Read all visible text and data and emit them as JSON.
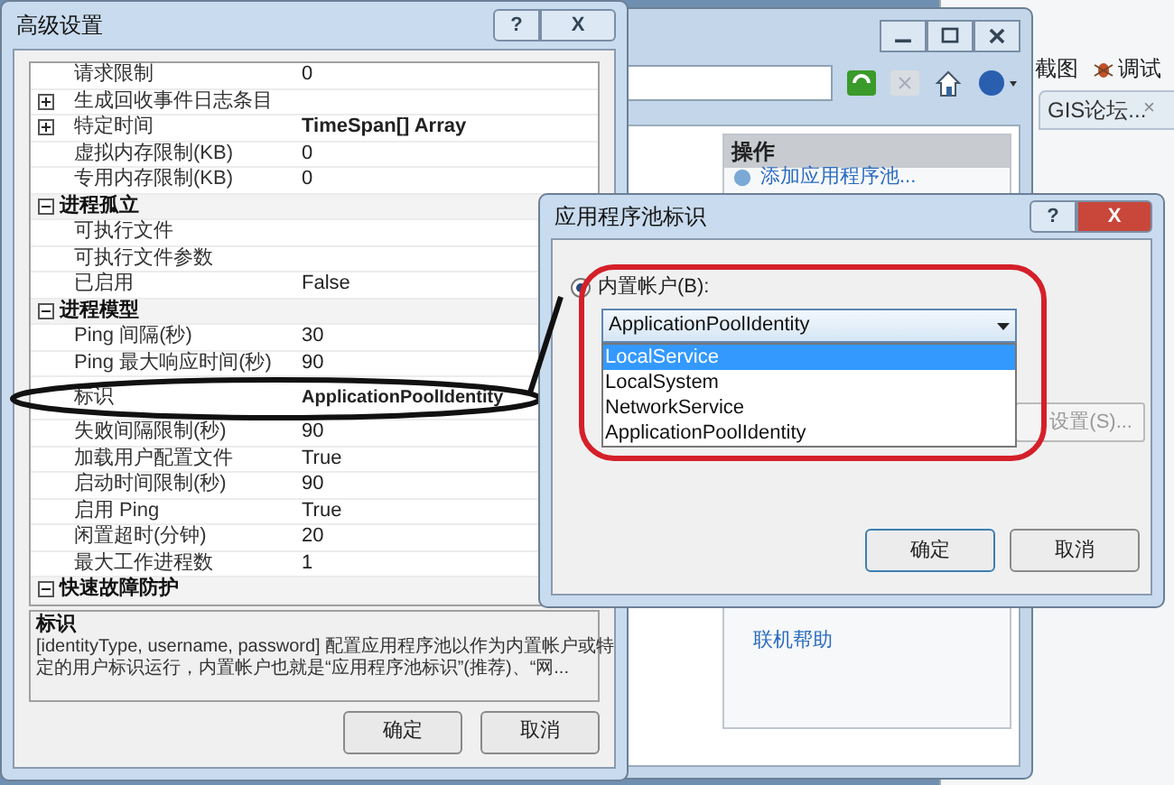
{
  "browser": {
    "toolbar": [
      "截图",
      "调试"
    ],
    "tab": {
      "label": "GIS论坛...",
      "close": "×"
    }
  },
  "iis_window": {
    "actions": {
      "title": "操作",
      "items": [
        "添加应用程序池...",
        "联机帮助"
      ]
    }
  },
  "advanced_settings": {
    "title": "高级设置",
    "help": "?",
    "close": "X",
    "rows": [
      {
        "kind": "property",
        "name": "请求限制",
        "value": "0",
        "bold": false
      },
      {
        "kind": "property",
        "expanded": false,
        "name": "生成回收事件日志条目"
      },
      {
        "kind": "property",
        "expanded": false,
        "name": "特定时间",
        "value": "TimeSpan[] Array",
        "bold": true
      },
      {
        "kind": "property",
        "name": "虚拟内存限制(KB)",
        "value": "0",
        "bold": false
      },
      {
        "kind": "property",
        "name": "专用内存限制(KB)",
        "value": "0",
        "bold": false
      },
      {
        "kind": "category",
        "expanded": true,
        "name": "进程孤立"
      },
      {
        "kind": "property",
        "name": "可执行文件"
      },
      {
        "kind": "property",
        "name": "可执行文件参数"
      },
      {
        "kind": "property",
        "name": "已启用",
        "value": "False",
        "bold": false
      },
      {
        "kind": "category",
        "expanded": true,
        "name": "进程模型"
      },
      {
        "kind": "property",
        "name": "Ping 间隔(秒)",
        "value": "30",
        "bold": false
      },
      {
        "kind": "property",
        "name": "Ping 最大响应时间(秒)",
        "value": "90",
        "bold": false
      },
      {
        "kind": "property",
        "name": "标识",
        "value": "ApplicationPoolIdentity",
        "bold": true,
        "circled": true
      },
      {
        "kind": "property",
        "name": "失败间隔限制(秒)",
        "value": "90",
        "bold": false
      },
      {
        "kind": "property",
        "name": "加载用户配置文件",
        "value": "True",
        "bold": false
      },
      {
        "kind": "property",
        "name": "启动时间限制(秒)",
        "value": "90",
        "bold": false
      },
      {
        "kind": "property",
        "name": "启用 Ping",
        "value": "True",
        "bold": false
      },
      {
        "kind": "property",
        "name": "闲置超时(分钟)",
        "value": "20",
        "bold": false
      },
      {
        "kind": "property",
        "name": "最大工作进程数",
        "value": "1",
        "bold": false
      },
      {
        "kind": "category",
        "expanded": true,
        "name": "快速故障防护"
      }
    ],
    "description": {
      "title": "标识",
      "text": "[identityType, username, password] 配置应用程序池以作为内置帐户或特定的用户标识运行，内置帐户也就是“应用程序池标识”(推荐)、“网..."
    },
    "buttons": [
      "确定",
      "取消"
    ]
  },
  "identity_dialog": {
    "title": "应用程序池标识",
    "help": "?",
    "close": "X",
    "radio": {
      "label": "内置帐户(B):",
      "selected": true
    },
    "combo": {
      "value": "ApplicationPoolIdentity",
      "open": true,
      "options": [
        {
          "label": "LocalService",
          "highlighted": true
        },
        {
          "label": "LocalSystem",
          "highlighted": false
        },
        {
          "label": "NetworkService",
          "highlighted": false
        },
        {
          "label": "ApplicationPoolIdentity",
          "highlighted": false
        }
      ]
    },
    "settings_button": "设置(S)...",
    "buttons": [
      "确定",
      "取消"
    ]
  }
}
